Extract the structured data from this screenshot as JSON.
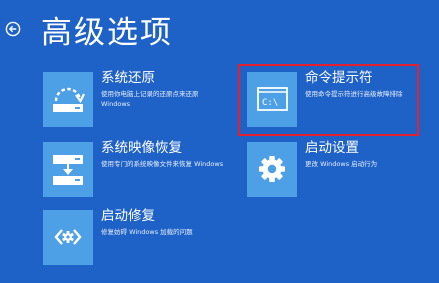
{
  "header": {
    "title": "高级选项",
    "back_icon": "back-arrow-circle-icon"
  },
  "options": [
    {
      "key": "system-restore",
      "title": "系统还原",
      "description": "使用你电脑上记录的还原点来还原 Windows",
      "icon": "restore-drive-icon"
    },
    {
      "key": "command-prompt",
      "title": "命令提示符",
      "description": "使用命令提示符进行高级故障排除",
      "icon": "command-prompt-icon"
    },
    {
      "key": "system-image-recovery",
      "title": "系统映像恢复",
      "description": "使用专门的系统映像文件来恢复 Windows",
      "icon": "image-recovery-icon"
    },
    {
      "key": "startup-settings",
      "title": "启动设置",
      "description": "更改 Windows 启动行为",
      "icon": "gear-icon"
    },
    {
      "key": "startup-repair",
      "title": "启动修复",
      "description": "修复妨碍 Windows 加载的问题",
      "icon": "startup-repair-icon"
    }
  ],
  "colors": {
    "background": "#1f62c7",
    "tile": "#4ea0e6",
    "highlight": "#e3202f"
  }
}
